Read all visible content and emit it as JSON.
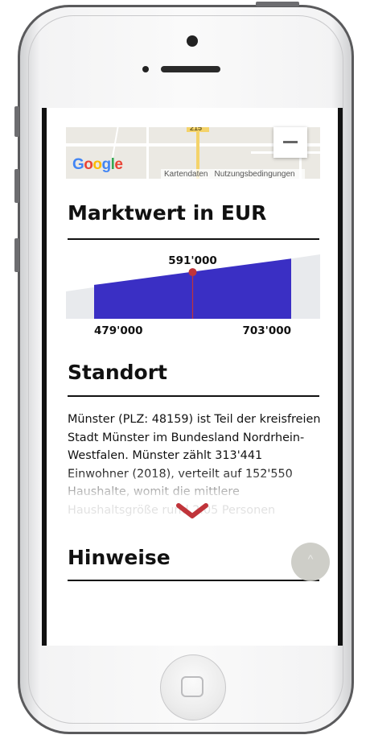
{
  "map": {
    "logo_text": "Google",
    "attribution_data": "Kartendaten",
    "attribution_terms": "Nutzungsbedingungen",
    "zoom_out_icon": "minus-icon",
    "road_label": "215"
  },
  "sections": {
    "marktwert_title": "Marktwert in EUR",
    "standort_title": "Standort",
    "hinweise_title": "Hinweise"
  },
  "chart_data": {
    "type": "area",
    "title": "",
    "low_label": "479'000",
    "mid_label": "591'000",
    "high_label": "703'000",
    "low": 479000,
    "mid": 591000,
    "high": 703000,
    "colors": {
      "band": "#3a2fc4",
      "track": "#e8eaed",
      "marker": "#c0343a"
    }
  },
  "standort_text": "Münster (PLZ: 48159) ist Teil der kreisfreien Stadt Münster im Bundesland Nordrhein-Westfalen. Münster zählt 313'441 Einwohner (2018), verteilt auf 152'550 Haushalte, womit die mittlere Haushaltsgröße rund 2.05 Personen",
  "expand_icon": "chevron-down-icon",
  "scroll_top_icon": "chevron-up-icon",
  "scroll_top_label": "^"
}
